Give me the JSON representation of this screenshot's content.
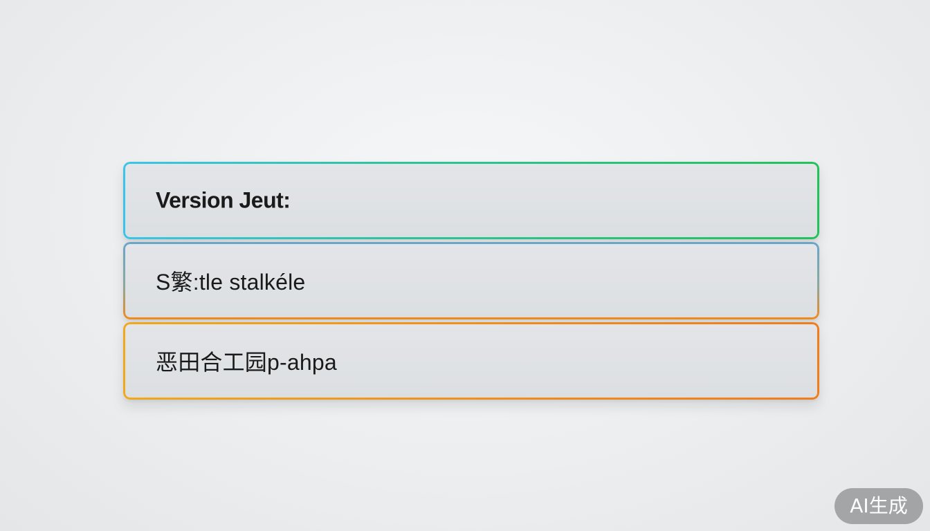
{
  "rows": [
    {
      "label": "Version  Jeut:"
    },
    {
      "label": "S繁:tle stalkéle"
    },
    {
      "label": "恶田合工园p-ahpa"
    }
  ],
  "watermark": {
    "label": "AI生成"
  },
  "colors": {
    "row1_border": [
      "#3cc4e8",
      "#22c25a"
    ],
    "row2_border": [
      "#6aa6c8",
      "#f08a1c"
    ],
    "row3_border": [
      "#f0a81c",
      "#f07c1c"
    ]
  }
}
